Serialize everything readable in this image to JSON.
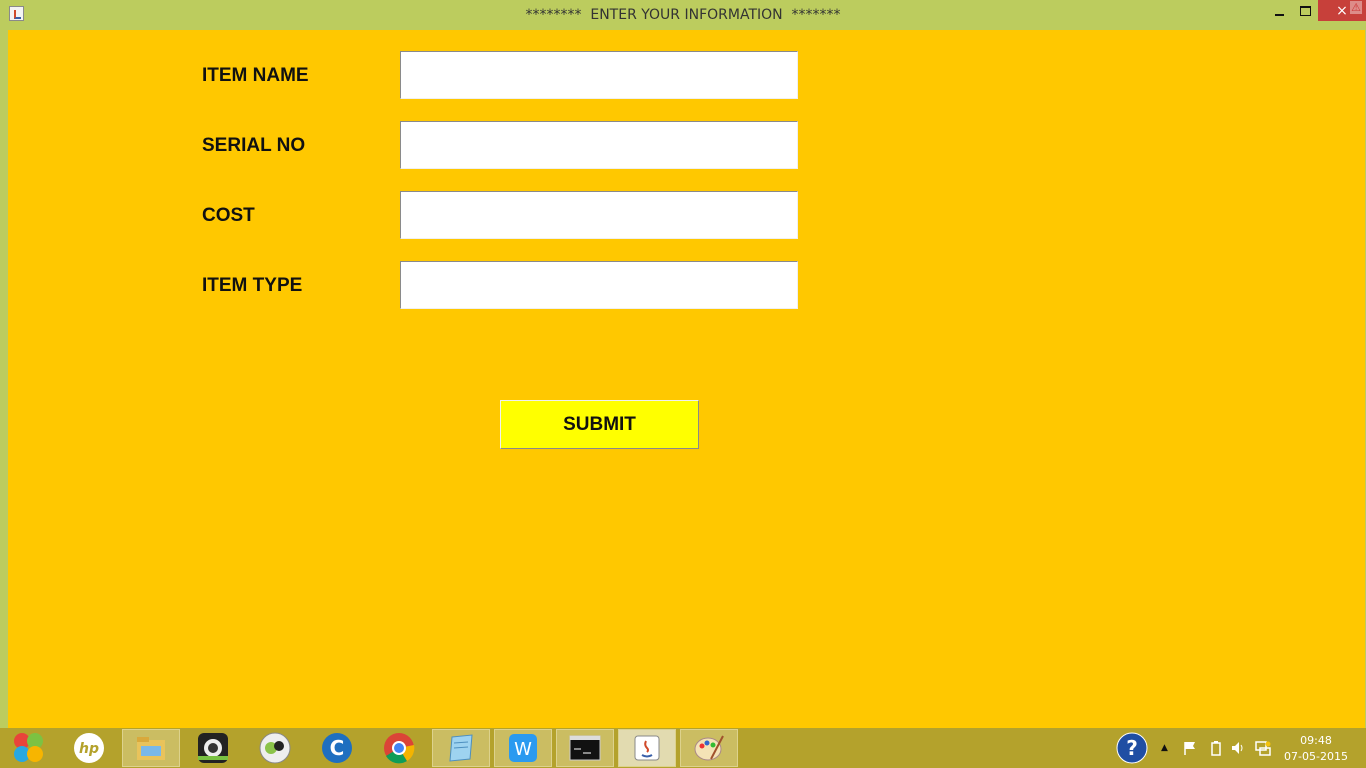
{
  "window": {
    "title": "********  ENTER YOUR INFORMATION  *******",
    "icon": "java-app-icon",
    "controls": {
      "minimize": "minimize-icon",
      "maximize": "maximize-icon",
      "close": "×"
    },
    "warning_badge": "⚠"
  },
  "form": {
    "fields": [
      {
        "label": "ITEM NAME",
        "value": ""
      },
      {
        "label": "SERIAL NO",
        "value": ""
      },
      {
        "label": "COST",
        "value": ""
      },
      {
        "label": "ITEM TYPE",
        "value": ""
      }
    ],
    "submit_label": "SUBMIT"
  },
  "colors": {
    "titlebar": "#bccc5e",
    "client": "#ffc800",
    "submit": "#ffff00",
    "taskbar": "#b4a22c"
  },
  "taskbar": {
    "items": [
      "start-icon",
      "hp-icon",
      "file-explorer-icon",
      "camera-app-icon",
      "media-app-icon",
      "ccleaner-icon",
      "chrome-icon",
      "notepad-icon",
      "wps-icon",
      "cmd-icon",
      "java-icon",
      "paint-icon"
    ],
    "tray": {
      "caret": "▲",
      "help": "?"
    },
    "clock": {
      "time": "09:48",
      "date": "07-05-2015"
    }
  }
}
